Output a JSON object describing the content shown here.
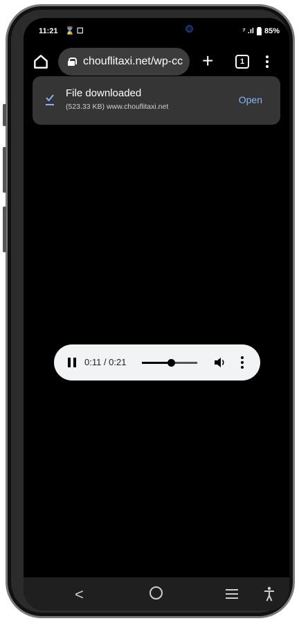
{
  "status_bar": {
    "time": "11:21",
    "battery": "85%",
    "left_icons": "⌛ ☐",
    "signal": "⁷ .ıl"
  },
  "browser": {
    "url": "chouflitaxi.net/wp-cc",
    "tab_count": "1"
  },
  "download": {
    "title": "File downloaded",
    "details": "(523.33 KB) www.chouflitaxi.net",
    "action_label": "Open"
  },
  "audio": {
    "time": "0:11 / 0:21",
    "progress": 0.52
  },
  "nav": {
    "back_glyph": "<"
  },
  "colors": {
    "accent_link": "#8ab4f8",
    "card_bg": "#353535",
    "player_bg": "#f1f3f4"
  }
}
